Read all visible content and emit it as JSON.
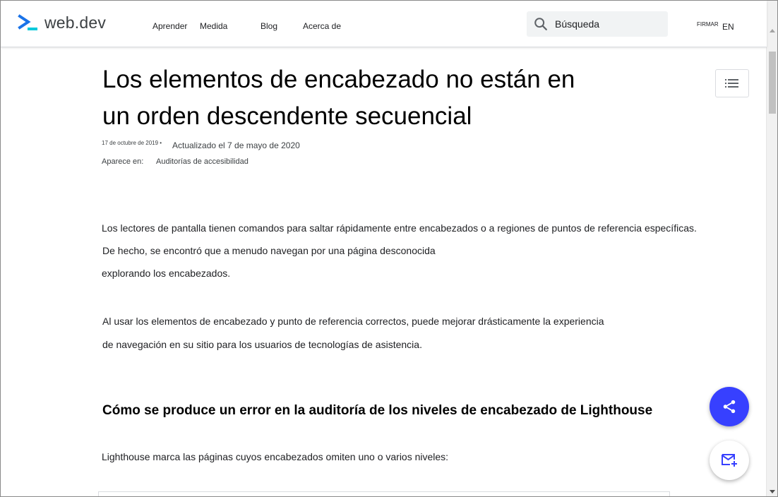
{
  "header": {
    "logo_text": "web.dev",
    "nav": [
      {
        "label": "Aprender"
      },
      {
        "label": "Medida"
      },
      {
        "label": "Blog"
      },
      {
        "label": "Acerca de"
      }
    ],
    "search_placeholder": "Búsqueda",
    "signin_label": "FIRMAR",
    "lang_label": "EN"
  },
  "article": {
    "title": "Los elementos de encabezado no están en un orden descendente secuencial",
    "published": "17 de octubre de 2019",
    "updated": "Actualizado el 7 de mayo de 2020",
    "appears_in_label": "Aparece en:",
    "appears_in_link": "Auditorías de accesibilidad",
    "p1_line1": "Los lectores de pantalla tienen comandos para saltar rápidamente entre encabezados o a regiones de puntos de referencia específicas.",
    "p1_line2": "De hecho, se encontró que a menudo navegan por una página desconocida",
    "p1_line3": "explorando los encabezados.",
    "p2_line1": "Al usar los elementos de encabezado y punto de referencia correctos, puede mejorar drásticamente la experiencia",
    "p2_line2": "de navegación en su sitio para los usuarios de tecnologías de asistencia.",
    "h2": "Cómo se produce un error en la auditoría de los niveles de encabezado de Lighthouse",
    "p3": "Lighthouse marca las páginas cuyos encabezados omiten uno o varios niveles:"
  },
  "colors": {
    "accent": "#3740ff",
    "logo_blue": "#1a73e8",
    "logo_teal": "#00c9db"
  },
  "icons": {
    "search": "search-icon",
    "toc": "list-icon",
    "share": "share-icon",
    "subscribe": "mail-add-icon"
  }
}
